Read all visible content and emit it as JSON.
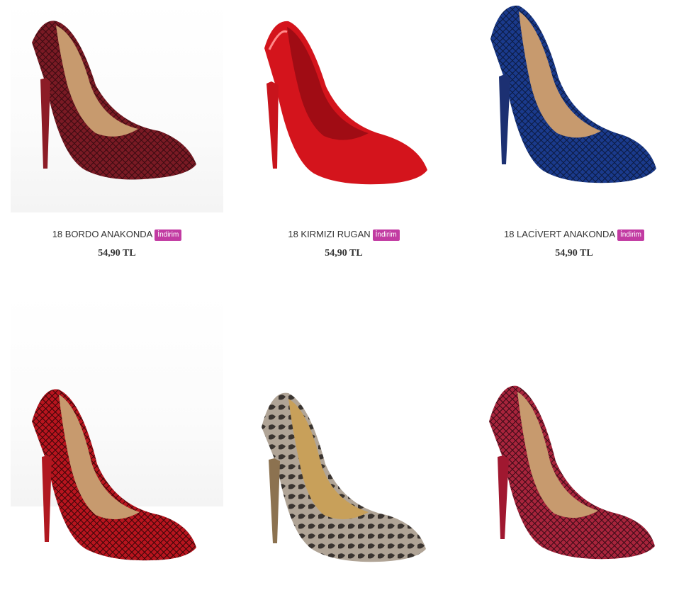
{
  "colors": {
    "badge": "#c23ba2",
    "text": "#333333"
  },
  "products": [
    {
      "name": "18 BORDO ANAKONDA",
      "badge": "İndirim",
      "price": "54,90 TL",
      "image": "burgundy-snakeskin-stiletto",
      "upper": "#7a1a24",
      "pattern": "#3a0a10",
      "heel": "#8c1c26"
    },
    {
      "name": "18 KIRMIZI RUGAN",
      "badge": "İndirim",
      "price": "54,90 TL",
      "image": "red-patent-stiletto",
      "upper": "#d4141c",
      "pattern": "",
      "heel": "#c8141c"
    },
    {
      "name": "18 LACİVERT ANAKONDA",
      "badge": "İndirim",
      "price": "54,90 TL",
      "image": "navy-snakeskin-stiletto",
      "upper": "#1a3a8c",
      "pattern": "#0c1a40",
      "heel": "#1c3072"
    },
    {
      "name": "",
      "badge": "",
      "price": "",
      "image": "red-snakeskin-stiletto",
      "upper": "#b8141e",
      "pattern": "#3a0608",
      "heel": "#b01820"
    },
    {
      "name": "",
      "badge": "",
      "price": "",
      "image": "beige-python-stiletto",
      "upper": "#b0a496",
      "pattern": "#3a3430",
      "heel": "#8c7250"
    },
    {
      "name": "",
      "badge": "",
      "price": "",
      "image": "fuchsia-snakeskin-stiletto",
      "upper": "#a8243c",
      "pattern": "#3a0a16",
      "heel": "#a01830"
    }
  ]
}
